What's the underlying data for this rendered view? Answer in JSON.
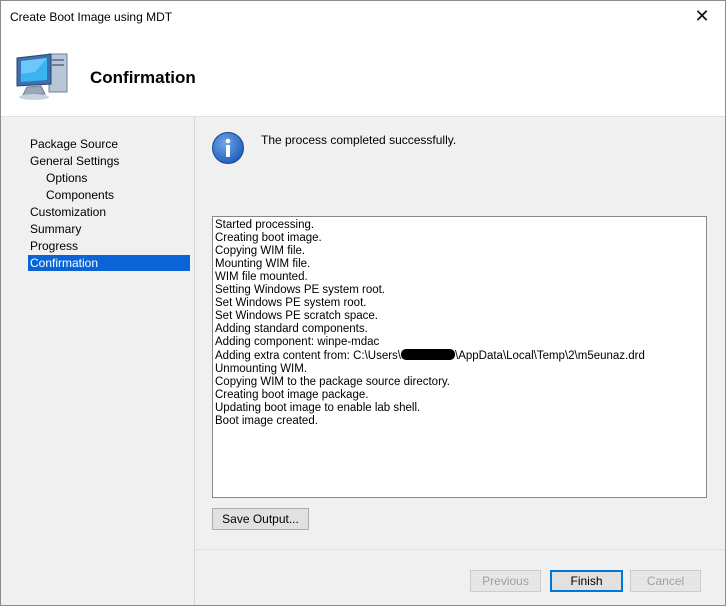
{
  "window": {
    "title": "Create Boot Image using MDT",
    "close_glyph": "✕"
  },
  "header": {
    "page_title": "Confirmation",
    "icon": "computer-icon"
  },
  "sidebar": {
    "items": [
      {
        "label": "Package Source"
      },
      {
        "label": "General Settings"
      },
      {
        "label": "Options"
      },
      {
        "label": "Components"
      },
      {
        "label": "Customization"
      },
      {
        "label": "Summary"
      },
      {
        "label": "Progress"
      },
      {
        "label": "Confirmation"
      }
    ],
    "selected": "Confirmation"
  },
  "content": {
    "status_icon": "info-icon",
    "status_message": "The process completed successfully.",
    "log_lines": [
      "Started processing.",
      "Creating boot image.",
      "Copying WIM file.",
      "Mounting WIM file.",
      "WIM file mounted.",
      "Setting Windows PE system root.",
      "Set Windows PE system root.",
      "Set Windows PE scratch space.",
      "Adding standard components.",
      "Adding component: winpe-mdac",
      "Adding extra content from: C:\\Users\\",
      "Unmounting WIM.",
      "Copying WIM to the package source directory.",
      "Creating boot image package.",
      "Updating boot image to enable lab shell.",
      "Boot image created."
    ],
    "log_line_11_suffix": "\\AppData\\Local\\Temp\\2\\m5eunaz.drd",
    "save_output_label": "Save Output..."
  },
  "buttons": {
    "previous": "Previous",
    "finish": "Finish",
    "cancel": "Cancel"
  },
  "colors": {
    "selection": "#0a64d6",
    "default_button_border": "#0078d7",
    "info_icon": "#1e5bb8"
  }
}
